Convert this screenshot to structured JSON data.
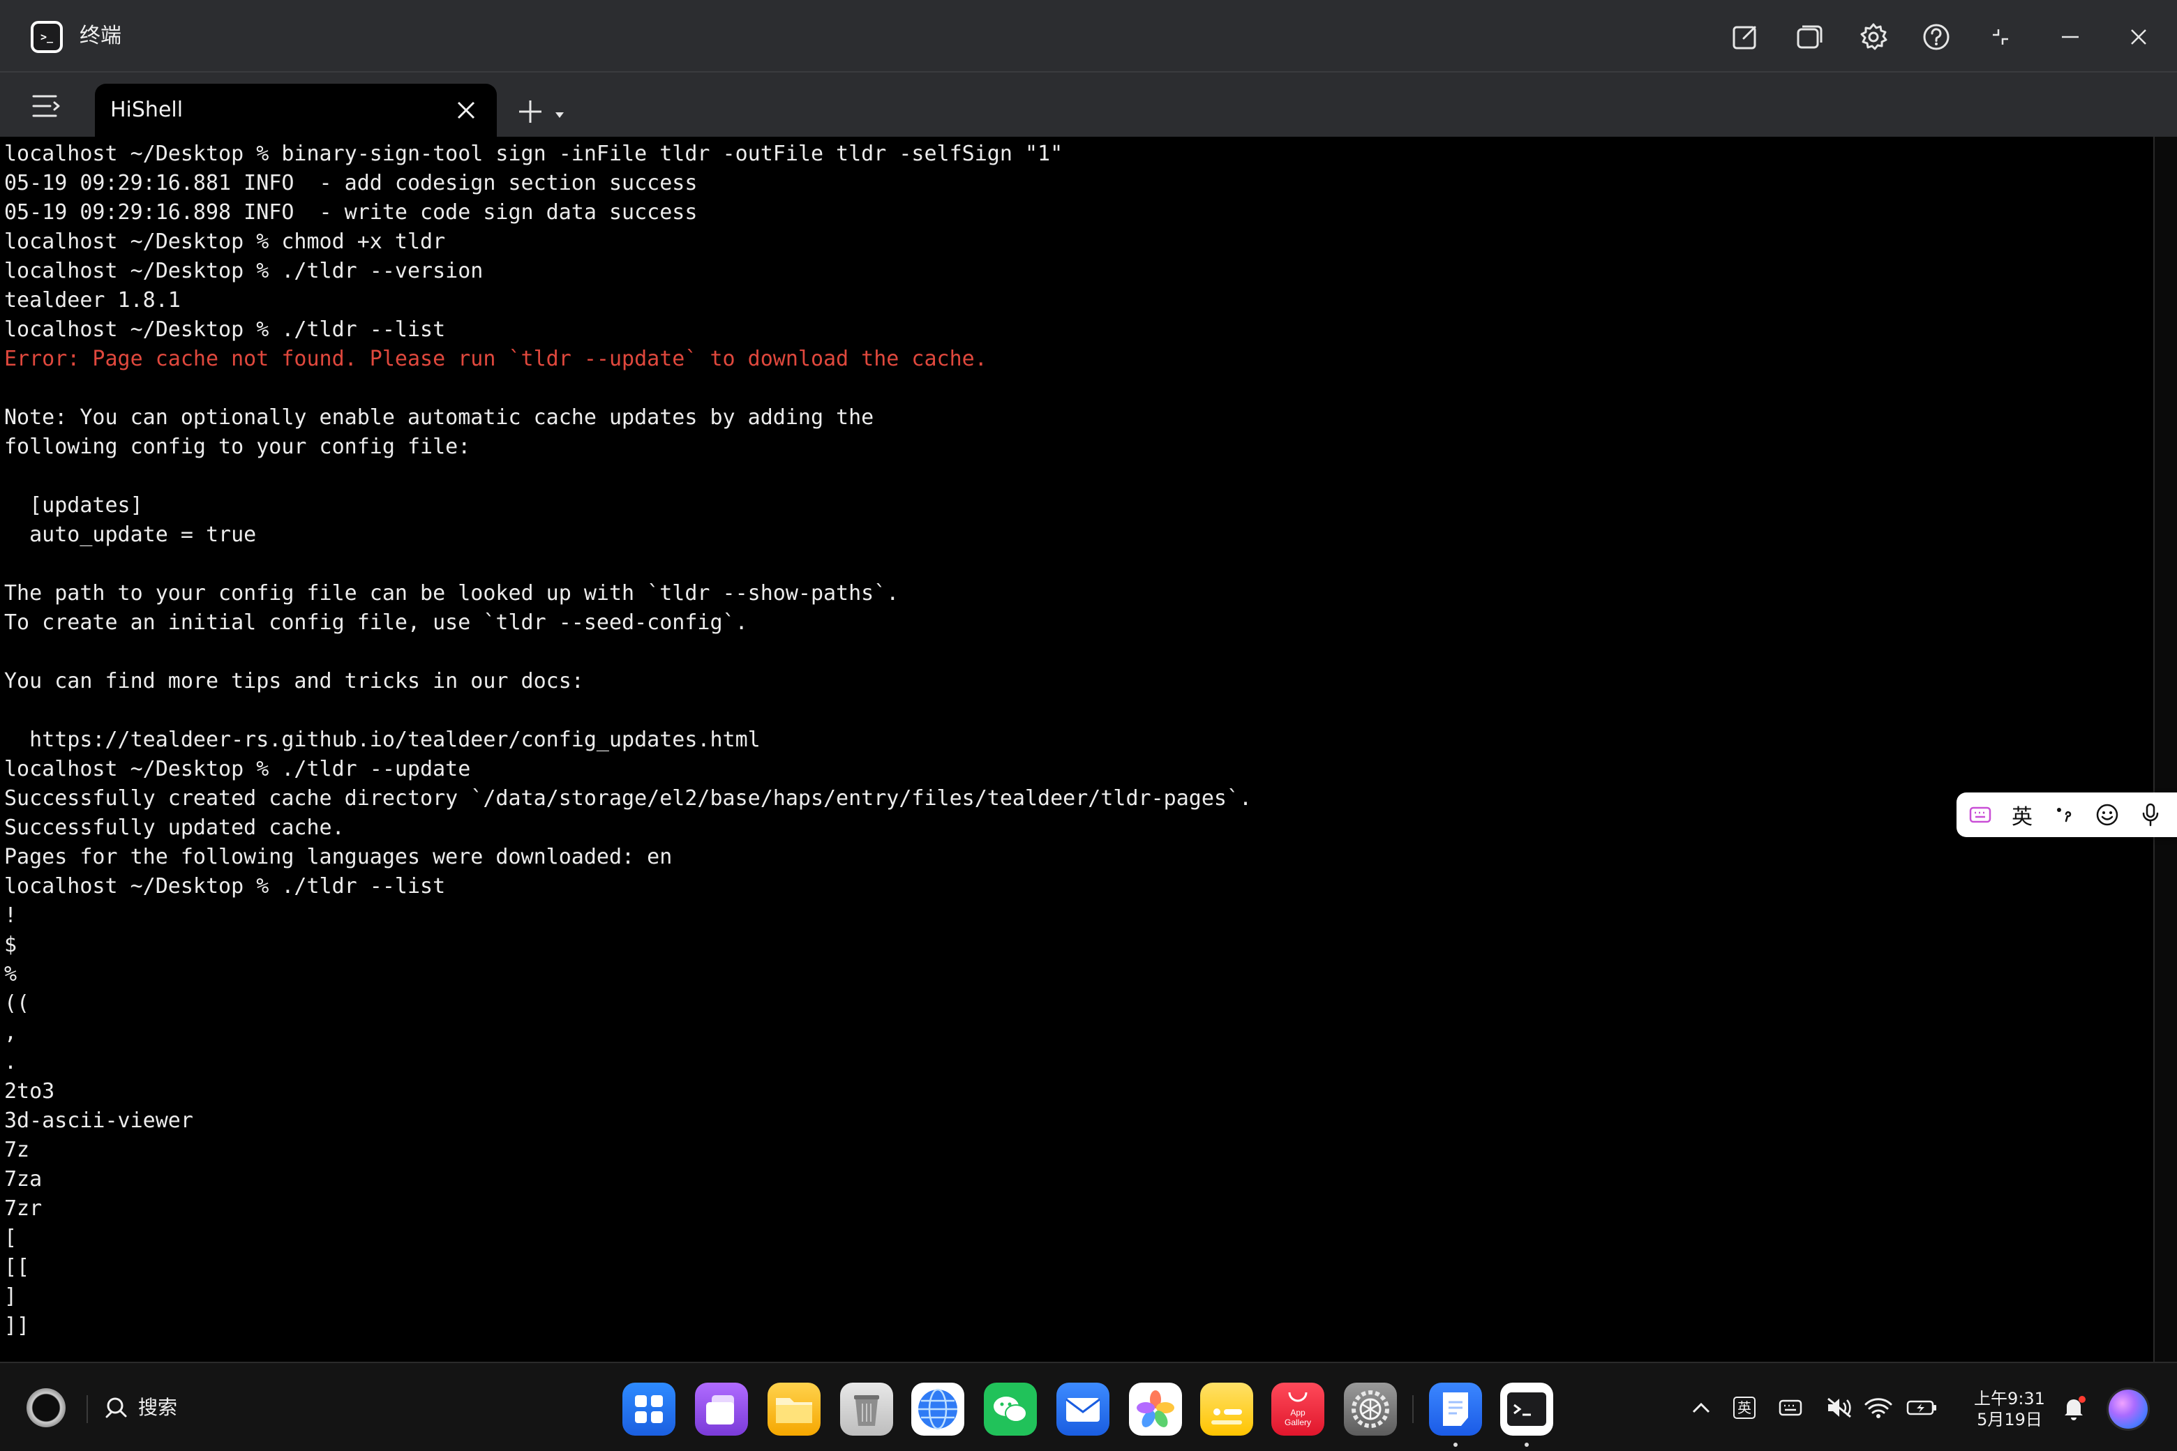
{
  "window": {
    "title": "终端"
  },
  "tabs": [
    {
      "label": "HiShell",
      "active": true
    }
  ],
  "terminal": {
    "lines": [
      {
        "text": "localhost ~/Desktop % binary-sign-tool sign -inFile tldr -outFile tldr -selfSign \"1\"",
        "kind": "normal"
      },
      {
        "text": "05-19 09:29:16.881 INFO  - add codesign section success",
        "kind": "normal"
      },
      {
        "text": "05-19 09:29:16.898 INFO  - write code sign data success",
        "kind": "normal"
      },
      {
        "text": "localhost ~/Desktop % chmod +x tldr",
        "kind": "normal"
      },
      {
        "text": "localhost ~/Desktop % ./tldr --version",
        "kind": "normal"
      },
      {
        "text": "tealdeer 1.8.1",
        "kind": "normal"
      },
      {
        "text": "localhost ~/Desktop % ./tldr --list",
        "kind": "normal"
      },
      {
        "text": "Error: Page cache not found. Please run `tldr --update` to download the cache.",
        "kind": "error"
      },
      {
        "text": "",
        "kind": "normal"
      },
      {
        "text": "Note: You can optionally enable automatic cache updates by adding the",
        "kind": "normal"
      },
      {
        "text": "following config to your config file:",
        "kind": "normal"
      },
      {
        "text": "",
        "kind": "normal"
      },
      {
        "text": "  [updates]",
        "kind": "normal"
      },
      {
        "text": "  auto_update = true",
        "kind": "normal"
      },
      {
        "text": "",
        "kind": "normal"
      },
      {
        "text": "The path to your config file can be looked up with `tldr --show-paths`.",
        "kind": "normal"
      },
      {
        "text": "To create an initial config file, use `tldr --seed-config`.",
        "kind": "normal"
      },
      {
        "text": "",
        "kind": "normal"
      },
      {
        "text": "You can find more tips and tricks in our docs:",
        "kind": "normal"
      },
      {
        "text": "",
        "kind": "normal"
      },
      {
        "text": "  https://tealdeer-rs.github.io/tealdeer/config_updates.html",
        "kind": "normal"
      },
      {
        "text": "localhost ~/Desktop % ./tldr --update",
        "kind": "normal"
      },
      {
        "text": "Successfully created cache directory `/data/storage/el2/base/haps/entry/files/tealdeer/tldr-pages`.",
        "kind": "normal"
      },
      {
        "text": "Successfully updated cache.",
        "kind": "normal"
      },
      {
        "text": "Pages for the following languages were downloaded: en",
        "kind": "normal"
      },
      {
        "text": "localhost ~/Desktop % ./tldr --list",
        "kind": "normal"
      },
      {
        "text": "!",
        "kind": "normal"
      },
      {
        "text": "$",
        "kind": "normal"
      },
      {
        "text": "%",
        "kind": "normal"
      },
      {
        "text": "((",
        "kind": "normal"
      },
      {
        "text": ",",
        "kind": "normal"
      },
      {
        "text": ".",
        "kind": "normal"
      },
      {
        "text": "2to3",
        "kind": "normal"
      },
      {
        "text": "3d-ascii-viewer",
        "kind": "normal"
      },
      {
        "text": "7z",
        "kind": "normal"
      },
      {
        "text": "7za",
        "kind": "normal"
      },
      {
        "text": "7zr",
        "kind": "normal"
      },
      {
        "text": "[",
        "kind": "normal"
      },
      {
        "text": "[[",
        "kind": "normal"
      },
      {
        "text": "]",
        "kind": "normal"
      },
      {
        "text": "]]",
        "kind": "normal"
      }
    ]
  },
  "ime": {
    "lang_label": "英"
  },
  "taskbar": {
    "search_label": "搜索",
    "dock": [
      {
        "name": "app-center",
        "icon": "grid-icon"
      },
      {
        "name": "multi-window",
        "icon": "windows-icon"
      },
      {
        "name": "files",
        "icon": "folder-icon"
      },
      {
        "name": "trash",
        "icon": "trash-icon"
      },
      {
        "name": "browser",
        "icon": "globe-icon"
      },
      {
        "name": "wechat",
        "icon": "chat-icon"
      },
      {
        "name": "mail",
        "icon": "mail-icon"
      },
      {
        "name": "photos",
        "icon": "flower-icon"
      },
      {
        "name": "notes",
        "icon": "notes-icon"
      },
      {
        "name": "app-gallery",
        "icon": "bag-icon",
        "label": "App Gallery"
      },
      {
        "name": "settings",
        "icon": "gear-icon"
      },
      {
        "name": "memo",
        "icon": "memo-icon",
        "running": true
      },
      {
        "name": "terminal",
        "icon": "terminal-icon",
        "running": true
      }
    ],
    "tray": {
      "ime_label": "英",
      "clock_time": "上午9:31",
      "clock_date": "5月19日"
    }
  },
  "colors": {
    "chrome": "#2c2d30",
    "terminal_bg": "#000000",
    "terminal_fg": "#ececec",
    "error": "#e0483d",
    "taskbar": "#141414"
  }
}
